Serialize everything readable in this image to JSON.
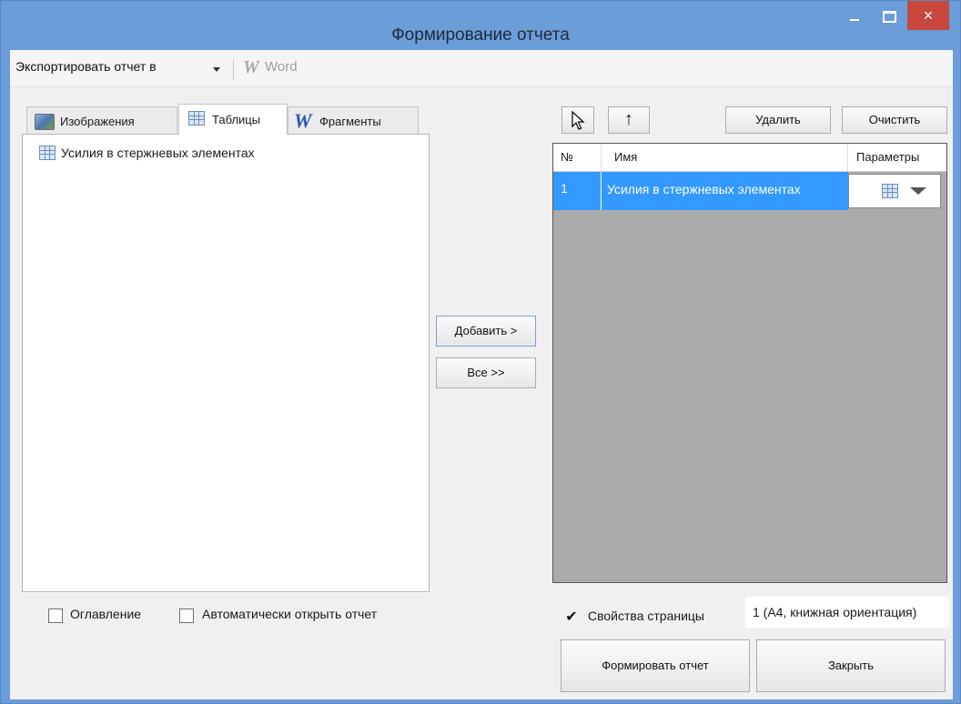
{
  "window": {
    "title": "Формирование отчета",
    "close_glyph": "×"
  },
  "toolbar": {
    "export_label": "Экспортировать отчет в",
    "word_icon": "W",
    "word_label": "Word"
  },
  "tabs": [
    {
      "label": "Изображения",
      "icon": "image-icon",
      "active": false
    },
    {
      "label": "Таблицы",
      "icon": "table-icon",
      "active": true
    },
    {
      "label": "Фрагменты",
      "icon": "word-icon",
      "active": false
    }
  ],
  "left_list": {
    "items": [
      {
        "label": "Усилия в стержневых элементах",
        "icon": "table-icon"
      }
    ]
  },
  "buttons": {
    "add": "Добавить >",
    "all": "Все >>",
    "up_arrow": "↑",
    "delete": "Удалить",
    "clear": "Очистить",
    "form_report": "Формировать отчет",
    "close": "Закрыть"
  },
  "grid": {
    "columns": [
      "№",
      "Имя",
      "Параметры"
    ],
    "rows": [
      {
        "num": "1",
        "name": "Усилия в стержневых элементах",
        "selected": true
      }
    ]
  },
  "options": {
    "toc_label": "Оглавление",
    "toc_checked": false,
    "auto_open_label": "Автоматически открыть отчет",
    "auto_open_checked": false,
    "page_props_label": "Свойства страницы",
    "page_props_checked": true,
    "page_props_value": "1 (А4, книжная ориентация)",
    "check_glyph": "✔"
  },
  "colors": {
    "title_bar": "#6b9dd9",
    "close_button": "#c9473d",
    "selection": "#3399ff",
    "grid_background": "#ababab"
  }
}
